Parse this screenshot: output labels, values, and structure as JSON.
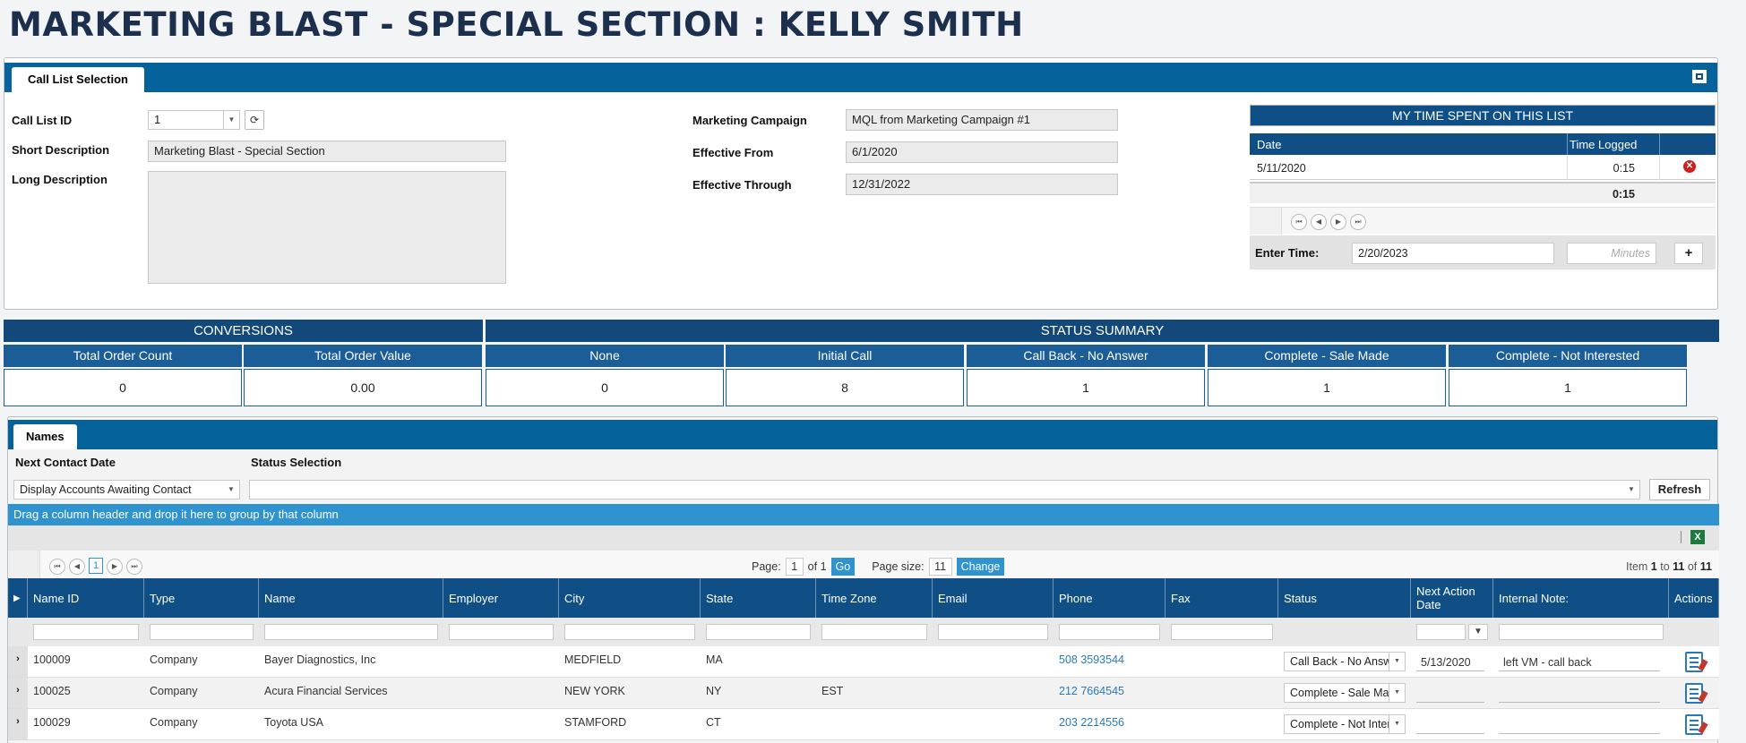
{
  "page": {
    "title": "MARKETING BLAST - SPECIAL SECTION : KELLY SMITH"
  },
  "call_list": {
    "tab_label": "Call List Selection",
    "id_label": "Call List ID",
    "id_value": "1",
    "short_desc_label": "Short Description",
    "short_desc_value": "Marketing Blast - Special Section",
    "long_desc_label": "Long Description",
    "long_desc_value": "",
    "campaign_label": "Marketing Campaign",
    "campaign_value": "MQL from Marketing Campaign #1",
    "eff_from_label": "Effective From",
    "eff_from_value": "6/1/2020",
    "eff_through_label": "Effective Through",
    "eff_through_value": "12/31/2022"
  },
  "time_spent": {
    "header": "MY TIME SPENT ON THIS LIST",
    "col_date": "Date",
    "col_time": "Time Logged",
    "rows": [
      {
        "date": "5/11/2020",
        "time": "0:15"
      }
    ],
    "total": "0:15",
    "enter_label": "Enter Time:",
    "enter_date": "2/20/2023",
    "minutes_placeholder": "Minutes",
    "add_label": "+"
  },
  "summary": {
    "conversions_header": "CONVERSIONS",
    "status_header": "STATUS SUMMARY",
    "columns": [
      {
        "label": "Total Order Count",
        "value": "0"
      },
      {
        "label": "Total Order Value",
        "value": "0.00"
      },
      {
        "label": "None",
        "value": "0"
      },
      {
        "label": "Initial Call",
        "value": "8"
      },
      {
        "label": "Call Back - No Answer",
        "value": "1"
      },
      {
        "label": "Complete - Sale Made",
        "value": "1"
      },
      {
        "label": "Complete - Not Interested",
        "value": "1"
      }
    ]
  },
  "names": {
    "tab_label": "Names",
    "next_contact_label": "Next Contact Date",
    "status_selection_label": "Status Selection",
    "next_contact_value": "Display Accounts Awaiting Contact",
    "status_selection_value": "",
    "refresh_label": "Refresh",
    "group_hint": "Drag a column header and drop it here to group by that column",
    "pager": {
      "current": "1",
      "page_label": "Page:",
      "page_value": "1",
      "of_label": "of 1",
      "go_label": "Go",
      "size_label": "Page size:",
      "size_value": "11",
      "change_label": "Change",
      "item_prefix": "Item",
      "item_from": "1",
      "item_to_label": "to",
      "item_to": "11",
      "item_of_label": "of",
      "item_total": "11"
    },
    "columns": [
      "Name ID",
      "Type",
      "Name",
      "Employer",
      "City",
      "State",
      "Time Zone",
      "Email",
      "Phone",
      "Fax",
      "Status",
      "Next Action Date",
      "Internal Note:",
      "Actions"
    ],
    "rows": [
      {
        "id": "100009",
        "type": "Company",
        "name": "Bayer Diagnostics, Inc",
        "employer": "",
        "city": "MEDFIELD",
        "state": "MA",
        "tz": "",
        "email": "",
        "phone": "508 3593544",
        "fax": "",
        "status": "Call Back - No Answer",
        "next_date": "5/13/2020",
        "note": "left VM - call back"
      },
      {
        "id": "100025",
        "type": "Company",
        "name": "Acura Financial Services",
        "employer": "",
        "city": "NEW YORK",
        "state": "NY",
        "tz": "EST",
        "email": "",
        "phone": "212 7664545",
        "fax": "",
        "status": "Complete - Sale Made",
        "next_date": "",
        "note": ""
      },
      {
        "id": "100029",
        "type": "Company",
        "name": "Toyota USA",
        "employer": "",
        "city": "STAMFORD",
        "state": "CT",
        "tz": "",
        "email": "",
        "phone": "203 2214556",
        "fax": "",
        "status": "Complete - Not Interested",
        "next_date": "",
        "note": ""
      }
    ]
  }
}
